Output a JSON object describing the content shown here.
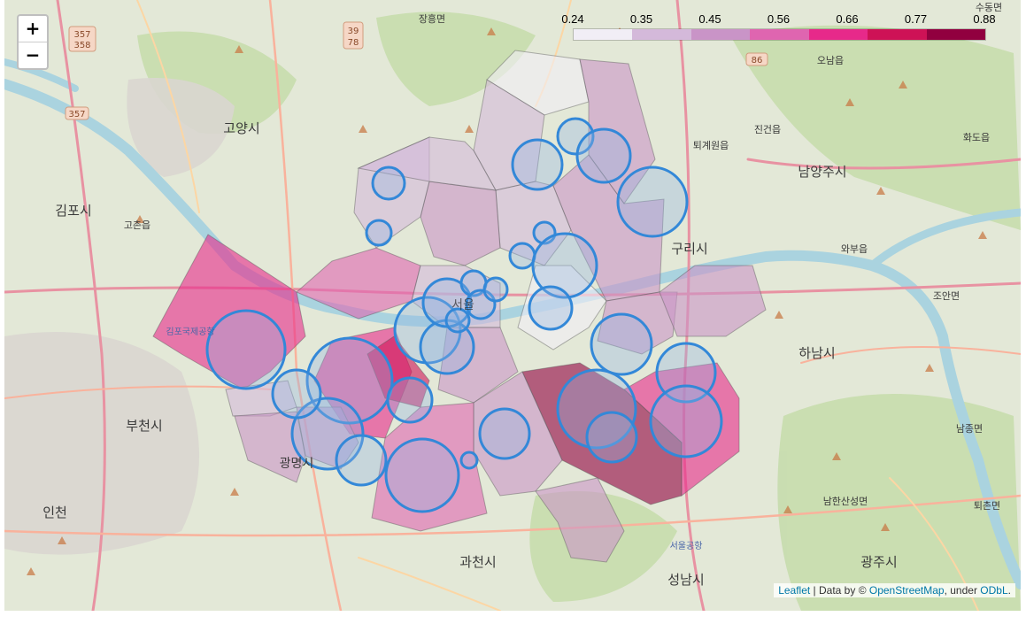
{
  "zoom": {
    "in_label": "+",
    "out_label": "−"
  },
  "legend": {
    "ticks": [
      "0.24",
      "0.35",
      "0.45",
      "0.56",
      "0.66",
      "0.77",
      "0.88"
    ],
    "colors": [
      "#f1eef6",
      "#d4b9da",
      "#c994c7",
      "#df65b0",
      "#e7298a",
      "#ce1256",
      "#91003f"
    ]
  },
  "attribution": {
    "leaflet": "Leaflet",
    "sep": " | Data by © ",
    "osm": "OpenStreetMap",
    "under": ", under ",
    "odbl": "ODbL",
    "end": "."
  },
  "place_labels": {
    "goyang": "고양시",
    "gimpo": "김포시",
    "bucheon": "부천시",
    "incheon": "인천",
    "gwangmyeong": "광명시",
    "gwacheon": "과천시",
    "seongnam": "성남시",
    "gwangju": "광주시",
    "hanam": "하남시",
    "guri": "구리시",
    "namyangju": "남양주시",
    "jinjeon": "진건읍",
    "hwado": "화도읍",
    "joan": "조안면",
    "toechon": "퇴촌면",
    "namjong": "남종면",
    "namhansan": "남한산성면",
    "wabu": "와부읍",
    "onam": "오남읍",
    "toegye": "퇴계원읍",
    "jangheung": "장흥면",
    "gochon": "고촌읍",
    "sudong": "수동면",
    "seoul_airport": "서울공항",
    "gimpo_airport": "김포국제공항",
    "seoul": "서울"
  },
  "road_shields": [
    "357",
    "358",
    "39",
    "78",
    "86"
  ],
  "map_data": {
    "layer": "choropleth",
    "districts": [
      {
        "id": "d01",
        "value": 0.33
      },
      {
        "id": "d02",
        "value": 0.45
      },
      {
        "id": "d03",
        "value": 0.4
      },
      {
        "id": "d04",
        "value": 0.48
      },
      {
        "id": "d05",
        "value": 0.38
      },
      {
        "id": "d06",
        "value": 0.46
      },
      {
        "id": "d07",
        "value": 0.42
      },
      {
        "id": "d08",
        "value": 0.36
      },
      {
        "id": "d09",
        "value": 0.52
      },
      {
        "id": "d10",
        "value": 0.4
      },
      {
        "id": "d11",
        "value": 0.26
      },
      {
        "id": "d12",
        "value": 0.5
      },
      {
        "id": "d13",
        "value": 0.44
      },
      {
        "id": "d14",
        "value": 0.45
      },
      {
        "id": "d15",
        "value": 0.66
      },
      {
        "id": "d16",
        "value": 0.74
      },
      {
        "id": "d17",
        "value": 0.62
      },
      {
        "id": "d18",
        "value": 0.4
      },
      {
        "id": "d19",
        "value": 0.43
      },
      {
        "id": "d20",
        "value": 0.45
      },
      {
        "id": "d21",
        "value": 0.88
      },
      {
        "id": "d22",
        "value": 0.66
      },
      {
        "id": "d23",
        "value": 0.45
      },
      {
        "id": "d24",
        "value": 0.56
      },
      {
        "id": "d25",
        "value": 0.45
      }
    ],
    "circle_count": 30
  }
}
